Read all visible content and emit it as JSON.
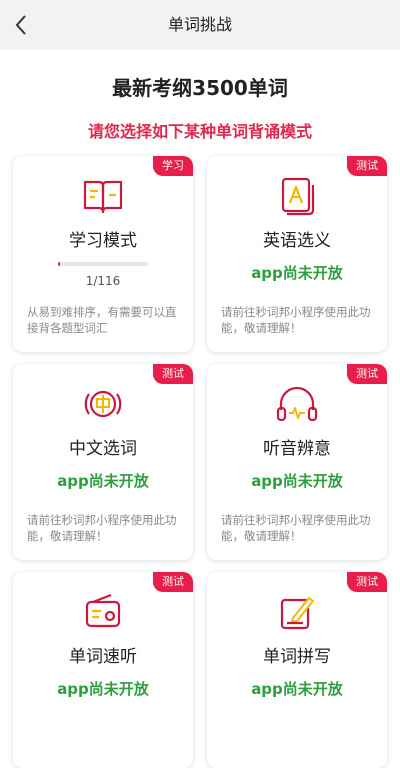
{
  "nav": {
    "title": "单词挑战"
  },
  "header": {
    "headline": "最新考纲3500单词",
    "subtitle": "请您选择如下某种单词背诵模式"
  },
  "colors": {
    "accent": "#e81e4a",
    "available_text": "#2e9e3e",
    "icon_stroke": "#c8193e",
    "icon_fill": "#f5b800"
  },
  "cards": [
    {
      "title": "学习模式",
      "badge": "学习",
      "icon": "book-icon",
      "progress": {
        "current": 1,
        "total": 116,
        "text": "1/116"
      },
      "desc": "从易到难排序，有需要可以直接背各题型词汇"
    },
    {
      "title": "英语选义",
      "badge": "测试",
      "icon": "letter-a-card-icon",
      "status": "app尚未开放",
      "desc": "请前往秒词邦小程序使用此功能，敬请理解！"
    },
    {
      "title": "中文选词",
      "badge": "测试",
      "icon": "chinese-char-icon",
      "status": "app尚未开放",
      "desc": "请前往秒词邦小程序使用此功能，敬请理解！"
    },
    {
      "title": "听音辨意",
      "badge": "测试",
      "icon": "headphones-icon",
      "status": "app尚未开放",
      "desc": "请前往秒词邦小程序使用此功能，敬请理解！"
    },
    {
      "title": "单词速听",
      "badge": "测试",
      "icon": "radio-icon",
      "status": "app尚未开放"
    },
    {
      "title": "单词拼写",
      "badge": "测试",
      "icon": "pencil-edit-icon",
      "status": "app尚未开放"
    }
  ]
}
